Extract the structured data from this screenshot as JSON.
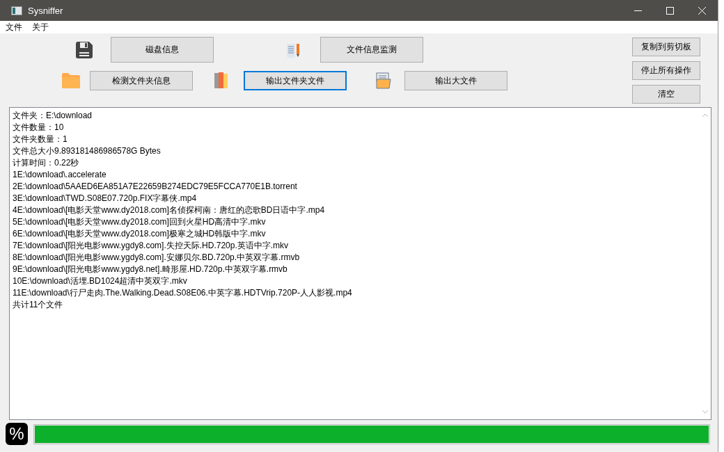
{
  "window": {
    "title": "Sysniffer"
  },
  "menu": [
    "文件",
    "关于"
  ],
  "tool_rows": [
    {
      "buttons": [
        {
          "label": "磁盘信息",
          "focused": false
        },
        {
          "label": "文件信息监测",
          "focused": false
        }
      ]
    },
    {
      "buttons": [
        {
          "label": "检测文件夹信息",
          "focused": false
        },
        {
          "label": "输出文件夹文件",
          "focused": true
        },
        {
          "label": "输出大文件",
          "focused": false
        }
      ]
    }
  ],
  "side_buttons": [
    "复制到剪切板",
    "停止所有操作",
    "清空"
  ],
  "output_lines": [
    "文件夹：E:\\download",
    "文件数量：10",
    "文件夹数量：1",
    "文件总大小9.893181486986578G Bytes",
    "计算时间：0.22秒",
    "1E:\\download\\.accelerate",
    "2E:\\download\\5AAED6EA851A7E22659B274EDC79E5FCCA770E1B.torrent",
    "3E:\\download\\TWD.S08E07.720p.FIX字幕侠.mp4",
    "4E:\\download\\[电影天堂www.dy2018.com]名侦探柯南：唐红的恋歌BD日语中字.mp4",
    "5E:\\download\\[电影天堂www.dy2018.com]回到火星HD高清中字.mkv",
    "6E:\\download\\[电影天堂www.dy2018.com]极寒之城HD韩版中字.mkv",
    "7E:\\download\\[阳光电影www.ygdy8.com].失控天际.HD.720p.英语中字.mkv",
    "8E:\\download\\[阳光电影www.ygdy8.com].安娜贝尔.BD.720p.中英双字幕.rmvb",
    "9E:\\download\\[阳光电影www.ygdy8.net].畸形屋.HD.720p.中英双字幕.rmvb",
    "10E:\\download\\活埋.BD1024超清中英双字.mkv",
    "11E:\\download\\行尸走肉.The.Walking.Dead.S08E06.中英字幕.HDTVrip.720P-人人影视.mp4",
    "共计11个文件"
  ],
  "progress": {
    "badge": "%",
    "level": 1
  }
}
